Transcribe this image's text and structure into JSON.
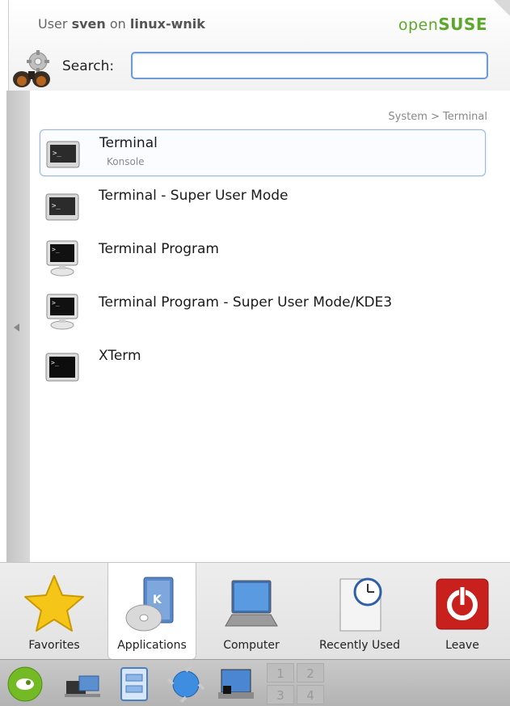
{
  "header": {
    "user_prefix": "User",
    "username": "sven",
    "host_prefix": "on",
    "hostname": "linux-wnik",
    "brand_part1": "open",
    "brand_part2": "SUSE",
    "search_label": "Search:",
    "search_value": ""
  },
  "breadcrumb": "System >  Terminal",
  "results": [
    {
      "title": "Terminal",
      "subtitle": "Konsole",
      "icon": "konsole-terminal-icon",
      "selected": true
    },
    {
      "title": "Terminal - Super User Mode",
      "subtitle": "",
      "icon": "konsole-terminal-icon",
      "selected": false
    },
    {
      "title": "Terminal Program",
      "subtitle": "",
      "icon": "monitor-terminal-icon",
      "selected": false
    },
    {
      "title": "Terminal Program - Super User Mode/KDE3",
      "subtitle": "",
      "icon": "monitor-terminal-icon",
      "selected": false
    },
    {
      "title": "XTerm",
      "subtitle": "",
      "icon": "xterm-icon",
      "selected": false
    }
  ],
  "tabs": [
    {
      "label": "Favorites",
      "icon": "star-icon",
      "active": false
    },
    {
      "label": "Applications",
      "icon": "applications-icon",
      "active": true
    },
    {
      "label": "Computer",
      "icon": "laptop-icon",
      "active": false
    },
    {
      "label": "Recently Used",
      "icon": "clock-document-icon",
      "active": false
    },
    {
      "label": "Leave",
      "icon": "power-icon",
      "active": false
    }
  ],
  "taskbar": {
    "launcher_icon": "opensuse-gecko-icon",
    "items": [
      "network-icon",
      "file-manager-icon",
      "web-browser-icon",
      "show-desktop-icon"
    ],
    "pager": [
      "1",
      "2",
      "3",
      "4"
    ]
  },
  "colors": {
    "brand_green": "#5ca82a",
    "selection_border": "#9bb7e0",
    "leave_red": "#c8201c",
    "star_yellow": "#f5c518"
  }
}
